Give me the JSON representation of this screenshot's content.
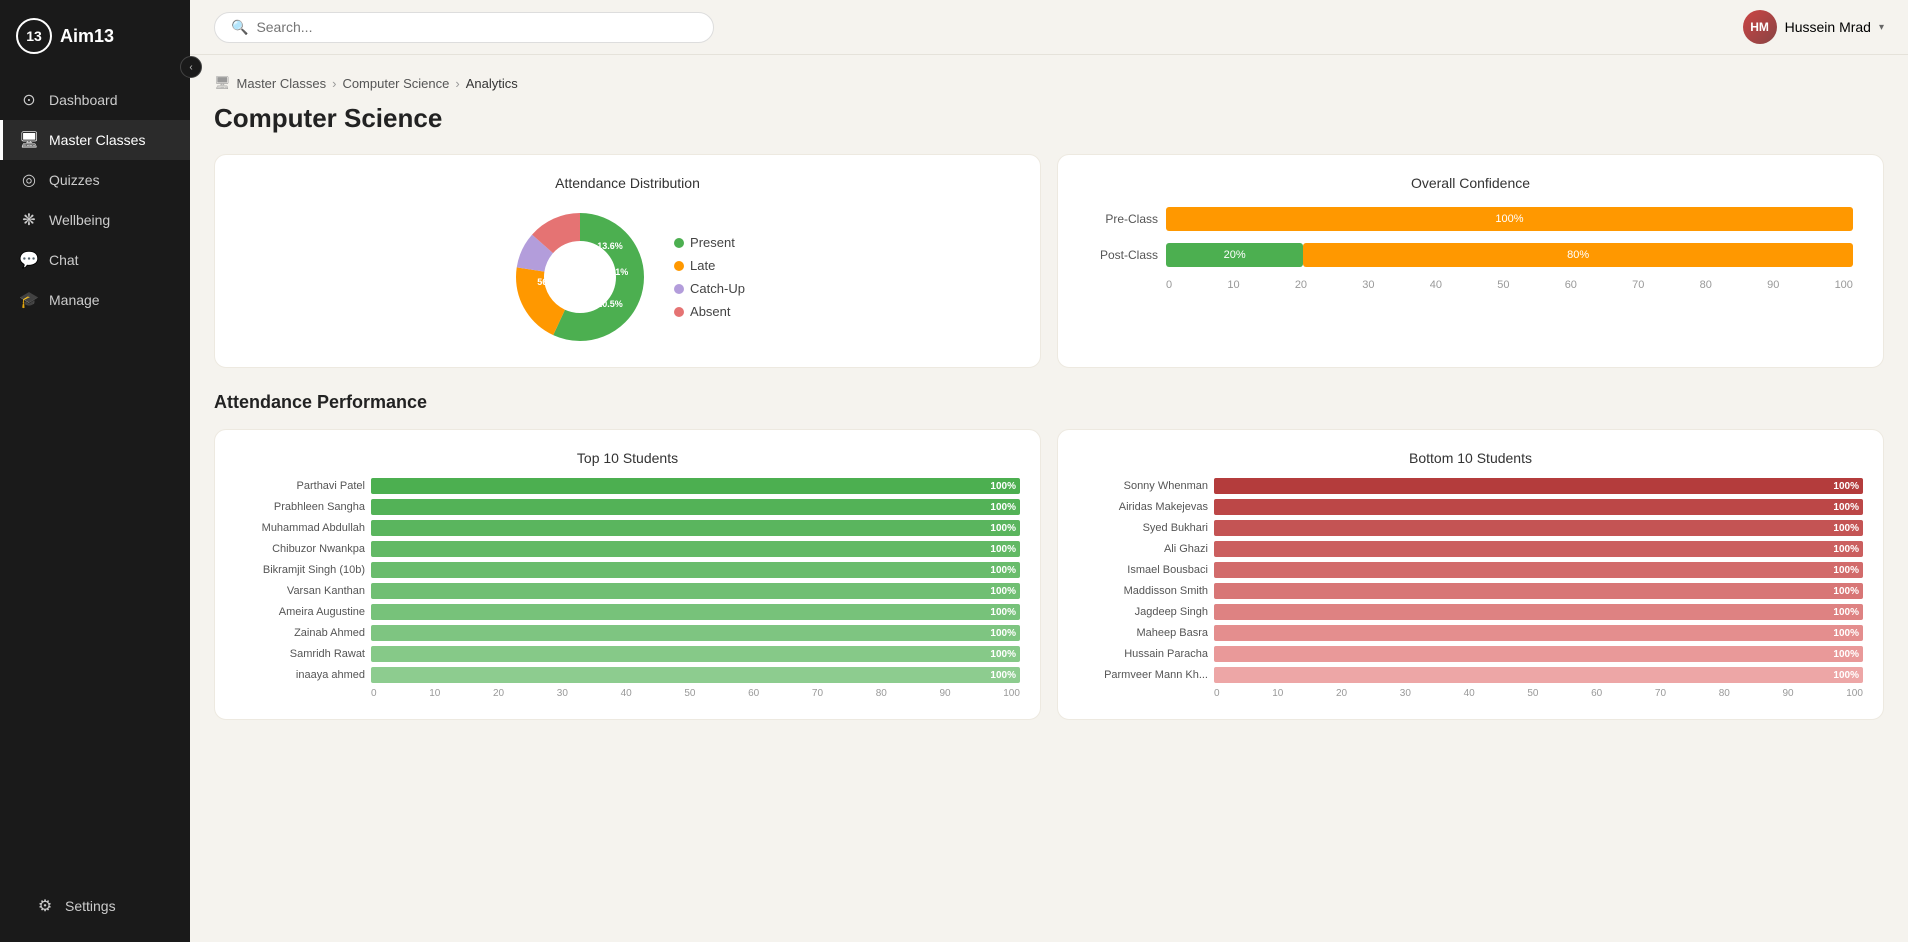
{
  "app": {
    "logo_number": "13",
    "logo_name": "Aim13"
  },
  "sidebar": {
    "collapse_icon": "‹",
    "items": [
      {
        "id": "dashboard",
        "label": "Dashboard",
        "icon": "⊙",
        "active": false
      },
      {
        "id": "master-classes",
        "label": "Master Classes",
        "icon": "🖥",
        "active": true
      },
      {
        "id": "quizzes",
        "label": "Quizzes",
        "icon": "◎",
        "active": false
      },
      {
        "id": "wellbeing",
        "label": "Wellbeing",
        "icon": "❋",
        "active": false
      },
      {
        "id": "chat",
        "label": "Chat",
        "icon": "💬",
        "active": false
      },
      {
        "id": "manage",
        "label": "Manage",
        "icon": "🎓",
        "active": false
      }
    ],
    "bottom_item": {
      "label": "Settings",
      "icon": "⚙"
    }
  },
  "header": {
    "search_placeholder": "Search...",
    "user_name": "Hussein Mrad",
    "user_initials": "HM"
  },
  "breadcrumb": {
    "items": [
      "Master Classes",
      "Computer Science",
      "Analytics"
    ]
  },
  "page": {
    "title": "Computer Science"
  },
  "attendance_distribution": {
    "title": "Attendance Distribution",
    "segments": [
      {
        "label": "Present",
        "value": 56.8,
        "color": "#4caf50",
        "text_color": "#4caf50"
      },
      {
        "label": "Late",
        "value": 20.5,
        "color": "#ff9800",
        "text_color": "#ff9800"
      },
      {
        "label": "Catch-Up",
        "value": 9.1,
        "color": "#b39ddb",
        "text_color": "#b39ddb"
      },
      {
        "label": "Absent",
        "value": 13.6,
        "color": "#e57373",
        "text_color": "#e57373"
      }
    ],
    "labels": {
      "present_pct": "56.8%",
      "late_pct": "20.5%",
      "catchup_pct": "9.1%",
      "absent_pct": "13.6%"
    }
  },
  "overall_confidence": {
    "title": "Overall Confidence",
    "rows": [
      {
        "label": "Pre-Class",
        "green_pct": 0,
        "orange_pct": 100,
        "green_label": "",
        "orange_label": "100%"
      },
      {
        "label": "Post-Class",
        "green_pct": 20,
        "orange_pct": 80,
        "green_label": "20%",
        "orange_label": "80%"
      }
    ],
    "axis": [
      "0",
      "10",
      "20",
      "30",
      "40",
      "50",
      "60",
      "70",
      "80",
      "90",
      "100"
    ]
  },
  "attendance_performance": {
    "section_title": "Attendance Performance",
    "top10": {
      "title": "Top 10 Students",
      "students": [
        {
          "name": "Parthavi Patel",
          "value": 100,
          "label": "100%"
        },
        {
          "name": "Prabhleen Sangha",
          "value": 100,
          "label": "100%"
        },
        {
          "name": "Muhammad Abdullah",
          "value": 100,
          "label": "100%"
        },
        {
          "name": "Chibuzor Nwankpa",
          "value": 100,
          "label": "100%"
        },
        {
          "name": "Bikramjit Singh (10b)",
          "value": 100,
          "label": "100%"
        },
        {
          "name": "Varsan Kanthan",
          "value": 100,
          "label": "100%"
        },
        {
          "name": "Ameira Augustine",
          "value": 100,
          "label": "100%"
        },
        {
          "name": "Zainab Ahmed",
          "value": 100,
          "label": "100%"
        },
        {
          "name": "Samridh Rawat",
          "value": 100,
          "label": "100%"
        },
        {
          "name": "inaaya ahmed",
          "value": 100,
          "label": "100%"
        }
      ],
      "axis": [
        "0",
        "10",
        "20",
        "30",
        "40",
        "50",
        "60",
        "70",
        "80",
        "90",
        "100"
      ],
      "bar_color": "#4caf50"
    },
    "bottom10": {
      "title": "Bottom 10 Students",
      "students": [
        {
          "name": "Sonny Whenman",
          "value": 100,
          "label": "100%",
          "opacity": 1.0
        },
        {
          "name": "Airidas Makejevas",
          "value": 100,
          "label": "100%",
          "opacity": 0.9
        },
        {
          "name": "Syed Bukhari",
          "value": 100,
          "label": "100%",
          "opacity": 0.8
        },
        {
          "name": "Ali Ghazi",
          "value": 100,
          "label": "100%",
          "opacity": 0.75
        },
        {
          "name": "Ismael Bousbaci",
          "value": 100,
          "label": "100%",
          "opacity": 0.7
        },
        {
          "name": "Maddisson Smith",
          "value": 100,
          "label": "100%",
          "opacity": 0.65
        },
        {
          "name": "Jagdeep Singh",
          "value": 100,
          "label": "100%",
          "opacity": 0.6
        },
        {
          "name": "Maheep Basra",
          "value": 100,
          "label": "100%",
          "opacity": 0.55
        },
        {
          "name": "Hussain Paracha",
          "value": 100,
          "label": "100%",
          "opacity": 0.5
        },
        {
          "name": "Parmveer Mann Kh...",
          "value": 100,
          "label": "100%",
          "opacity": 0.45
        }
      ],
      "axis": [
        "0",
        "10",
        "20",
        "30",
        "40",
        "50",
        "60",
        "70",
        "80",
        "90",
        "100"
      ],
      "bar_color": "#e53935"
    }
  }
}
